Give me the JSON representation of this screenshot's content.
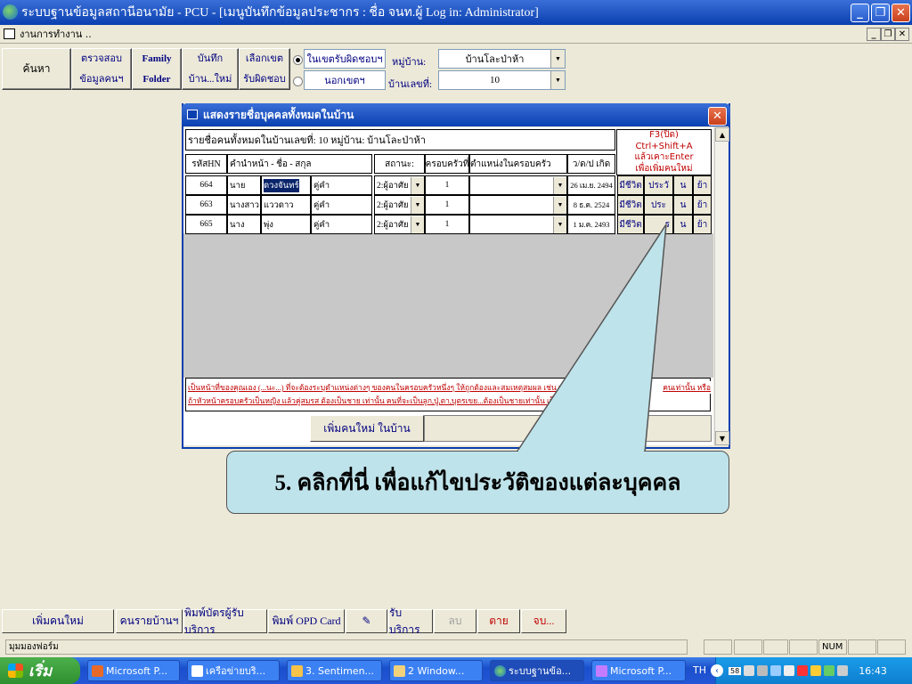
{
  "window": {
    "title": "ระบบฐานข้อมูลสถานีอนามัย - PCU - [เมนูบันทึกข้อมูลประชากร : ชื่อ จนท.ผู้ Log in: Administrator]",
    "minimize": "_",
    "restore": "❐",
    "close": "✕"
  },
  "mdi": {
    "title": "งานการทำงาน ..",
    "min": "_",
    "restore": "❐",
    "close": "✕"
  },
  "toolbar": {
    "search": "ค้นหา",
    "verify": [
      "ตรวจสอบ",
      "ข้อมูลคนฯ"
    ],
    "family_folder": [
      "Family",
      "Folder"
    ],
    "save_new": [
      "บันทึก",
      "บ้าน...ใหม่"
    ],
    "select_zone": [
      "เลือกเขต",
      "รับผิดชอบ"
    ],
    "zone_in": "ในเขตรับผิดชอบฯ",
    "zone_out": "นอกเขตฯ",
    "village_label": "หมู่บ้าน:",
    "village_value": "บ้านโละป่าห้า",
    "house_label": "บ้านเลขที่:",
    "house_value": "10"
  },
  "dialog": {
    "title": "แสดงรายชื่อบุคคลทั้งหมดในบ้าน",
    "caption": "รายชื่อคนทั้งหมดในบ้านเลขที่: 10 หมู่บ้าน: บ้านโละป่าห้า",
    "hint": [
      "F3(ปิด)",
      "Ctrl+Shift+A",
      "แล้วเคาะEnter",
      "เพื่อเพิ่มคนใหม่"
    ],
    "headers": {
      "hn": "รหัสHN",
      "name": "คำนำหน้า - ชื่อ - สกุล",
      "status": "สถานะ:",
      "family_no": "ครอบครัวที่",
      "position": "ตำแหน่งในครอบครัว",
      "dob": "ว/ด/ป เกิด"
    },
    "rows": [
      {
        "hn": "664",
        "prefix": "นาย",
        "first": "ดวงจันทร์",
        "last": "คู่คำ",
        "status": "2:ผู้อาศัย",
        "family": "1",
        "position": "",
        "dob": "26 เม.ย. 2494",
        "alive": "มีชีวิต",
        "history": "ประวั",
        "n": "น",
        "move": "ย้า"
      },
      {
        "hn": "663",
        "prefix": "นางสาว",
        "first": "แววดาว",
        "last": "คู่คำ",
        "status": "2:ผู้อาศัย",
        "family": "1",
        "position": "",
        "dob": "8 ธ.ค. 2524",
        "alive": "มีชีวิต",
        "history": "ประ",
        "n": "น",
        "move": "ย้า"
      },
      {
        "hn": "665",
        "prefix": "นาง",
        "first": "พุ่ง",
        "last": "คู่คำ",
        "status": "2:ผู้อาศัย",
        "family": "1",
        "position": "",
        "dob": "1 ม.ค. 2493",
        "alive": "มีชีวิต",
        "history": "ร",
        "n": "น",
        "move": "ย้า"
      }
    ],
    "note": [
      "เป็นหน้าที่ของคุณเอง (...นะ...) ที่จะต้องระบุตำแหน่งต่างๆ ของคนในครอบครัวหนึ่งๆ ให้ถูกต้องและสมเหตุสมผล เช่น หา",
      "ถ้าหัวหน้าครอบครัวเป็นหญิง แล้วคู่สมรส ต้องเป็นชาย เท่านั้น คนที่จะเป็นลูก,ปู่,ตา,บุตรเขย...ต้องเป็นชายเท่านั้น เป็",
      "คนเท่านั้น หรือ"
    ],
    "add_person": "เพิ่มคนใหม่ ในบ้าน"
  },
  "callout": "5. คลิกที่นี่ เพื่อแก้ไขประวัติของแต่ละบุคคล",
  "bottom": {
    "add_new": "เพิ่มคนใหม่",
    "per_house": "คนรายบ้านฯ",
    "print_card": "พิมพ์บัตรผู้รับบริการ",
    "print_opd": "พิมพ์ OPD Card",
    "service": "รับบริการ",
    "delete": "ลบ",
    "dead": "ตาย",
    "end": "จบ..."
  },
  "status": {
    "text": "มุมมองฟอร์ม",
    "num": "NUM"
  },
  "taskbar": {
    "start": "เริ่ม",
    "tasks": [
      "Microsoft P...",
      "เครือข่ายบริ...",
      "3. Sentimen...",
      "2 Window...",
      "ระบบฐานข้อ...",
      "Microsoft P..."
    ],
    "lang": "TH",
    "tray_num": "58",
    "clock": "16:43"
  },
  "colors": {
    "titlebar": "#0a3fb0",
    "callout": "#bfe3ea",
    "warning": "#c00000"
  }
}
